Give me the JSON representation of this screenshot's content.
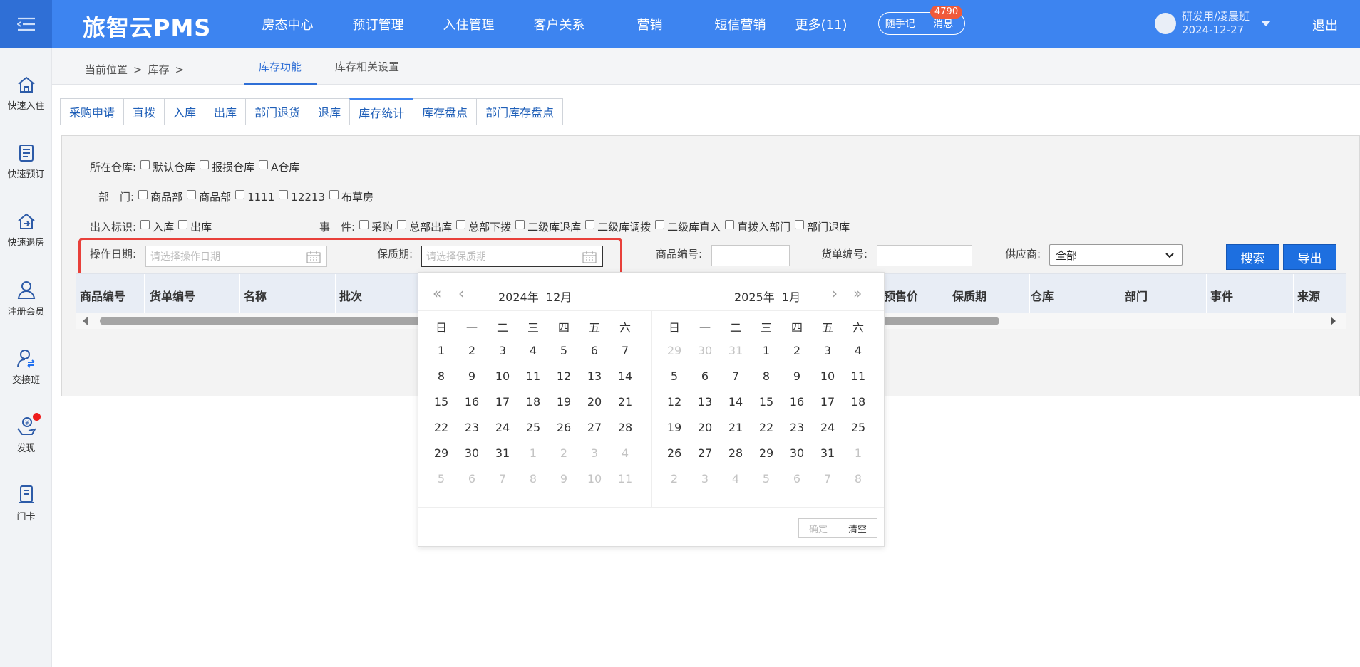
{
  "app": {
    "brand": "旅智云PMS"
  },
  "nav": [
    "房态中心",
    "预订管理",
    "入住管理",
    "客户关系",
    "营销",
    "短信营销",
    "更多(11)"
  ],
  "pill": {
    "notes": "随手记",
    "messages": "消息",
    "badge": "4790"
  },
  "user": {
    "name": "研发用/凌晨班",
    "date": "2024-12-27",
    "logout": "退出"
  },
  "sidebar": [
    {
      "label": "快速入住",
      "icon": "home-icon"
    },
    {
      "label": "快速预订",
      "icon": "booking-icon"
    },
    {
      "label": "快速退房",
      "icon": "checkout-icon"
    },
    {
      "label": "注册会员",
      "icon": "member-icon"
    },
    {
      "label": "交接班",
      "icon": "handover-icon"
    },
    {
      "label": "发现",
      "icon": "discover-icon"
    },
    {
      "label": "门卡",
      "icon": "doorcard-icon"
    }
  ],
  "breadcrumb": {
    "location": "当前位置",
    "section": "库存"
  },
  "top_tabs": [
    "库存功能",
    "库存相关设置"
  ],
  "sub_tabs": [
    "采购申请",
    "直拨",
    "入库",
    "出库",
    "部门退货",
    "退库",
    "库存统计",
    "库存盘点",
    "部门库存盘点"
  ],
  "filters": {
    "warehouse": {
      "label": "所在仓库:",
      "options": [
        "默认仓库",
        "报损仓库",
        "A仓库"
      ]
    },
    "department": {
      "label": "部　门:",
      "options": [
        "商品部",
        "商品部",
        "1111",
        "12213",
        "布草房"
      ]
    },
    "io_flag": {
      "label": "出入标识:",
      "options": [
        "入库",
        "出库"
      ]
    },
    "event": {
      "label": "事　件:",
      "options": [
        "采购",
        "总部出库",
        "总部下拨",
        "二级库退库",
        "二级库调拨",
        "二级库直入",
        "直拨入部门",
        "部门退库"
      ]
    },
    "op_date": {
      "label": "操作日期:",
      "placeholder": "请选择操作日期"
    },
    "shelf_life": {
      "label": "保质期:",
      "placeholder": "请选择保质期"
    },
    "product_code": {
      "label": "商品编号:",
      "value": ""
    },
    "order_code": {
      "label": "货单编号:",
      "value": ""
    },
    "supplier": {
      "label": "供应商:",
      "value": "全部"
    },
    "search_btn": "搜索",
    "export_btn": "导出"
  },
  "table": {
    "columns": [
      "商品编号",
      "货单编号",
      "名称",
      "批次",
      "预售价",
      "保质期",
      "仓库",
      "部门",
      "事件",
      "来源"
    ]
  },
  "datepicker": {
    "left_year": "2024年",
    "left_month": "12月",
    "right_year": "2025年",
    "right_month": "1月",
    "weekdays": [
      "日",
      "一",
      "二",
      "三",
      "四",
      "五",
      "六"
    ],
    "left_days": [
      [
        "1",
        "2",
        "3",
        "4",
        "5",
        "6",
        "7"
      ],
      [
        "8",
        "9",
        "10",
        "11",
        "12",
        "13",
        "14"
      ],
      [
        "15",
        "16",
        "17",
        "18",
        "19",
        "20",
        "21"
      ],
      [
        "22",
        "23",
        "24",
        "25",
        "26",
        "27",
        "28"
      ],
      [
        "29",
        "30",
        "31",
        "1",
        "2",
        "3",
        "4"
      ],
      [
        "5",
        "6",
        "7",
        "8",
        "9",
        "10",
        "11"
      ]
    ],
    "right_days": [
      [
        "29",
        "30",
        "31",
        "1",
        "2",
        "3",
        "4"
      ],
      [
        "5",
        "6",
        "7",
        "8",
        "9",
        "10",
        "11"
      ],
      [
        "12",
        "13",
        "14",
        "15",
        "16",
        "17",
        "18"
      ],
      [
        "19",
        "20",
        "21",
        "22",
        "23",
        "24",
        "25"
      ],
      [
        "26",
        "27",
        "28",
        "29",
        "30",
        "31",
        "1"
      ],
      [
        "2",
        "3",
        "4",
        "5",
        "6",
        "7",
        "8"
      ]
    ],
    "confirm": "确定",
    "clear": "清空"
  },
  "colors": {
    "primary": "#3d84f0",
    "highlight": "#e8403a",
    "badge": "#f05a3a"
  }
}
